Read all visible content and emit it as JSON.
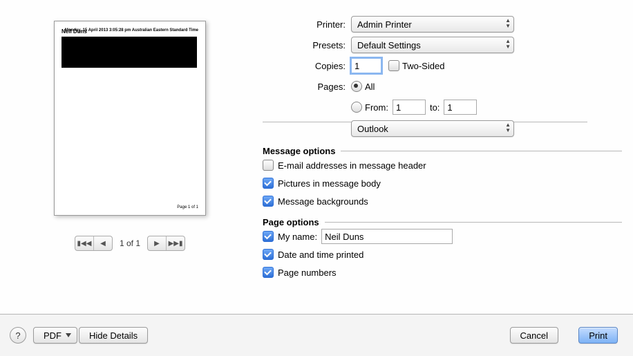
{
  "labels": {
    "printer": "Printer:",
    "presets": "Presets:",
    "copies": "Copies:",
    "twoSided": "Two-Sided",
    "pages": "Pages:",
    "all": "All",
    "from": "From:",
    "to": "to:"
  },
  "values": {
    "printer": "Admin Printer",
    "presets": "Default Settings",
    "copies": "1",
    "from": "1",
    "to": "1",
    "app": "Outlook"
  },
  "sections": {
    "messageOptions": "Message options",
    "pageOptions": "Page options"
  },
  "messageOptions": {
    "emailAddresses": "E-mail addresses in message header",
    "pictures": "Pictures in message body",
    "backgrounds": "Message backgrounds"
  },
  "pageOptions": {
    "myNameLabel": "My name:",
    "myNameValue": "Neil Duns",
    "dateTime": "Date and time printed",
    "pageNumbers": "Page numbers"
  },
  "pager": {
    "text": "1 of 1"
  },
  "preview": {
    "name": "Neil Duns",
    "date": "Monday, 15 April 2013 3:05:28 pm Australian Eastern Standard Time",
    "footer": "Page 1 of 1"
  },
  "footer": {
    "help": "?",
    "pdf": "PDF",
    "hide": "Hide Details",
    "cancel": "Cancel",
    "print": "Print"
  }
}
